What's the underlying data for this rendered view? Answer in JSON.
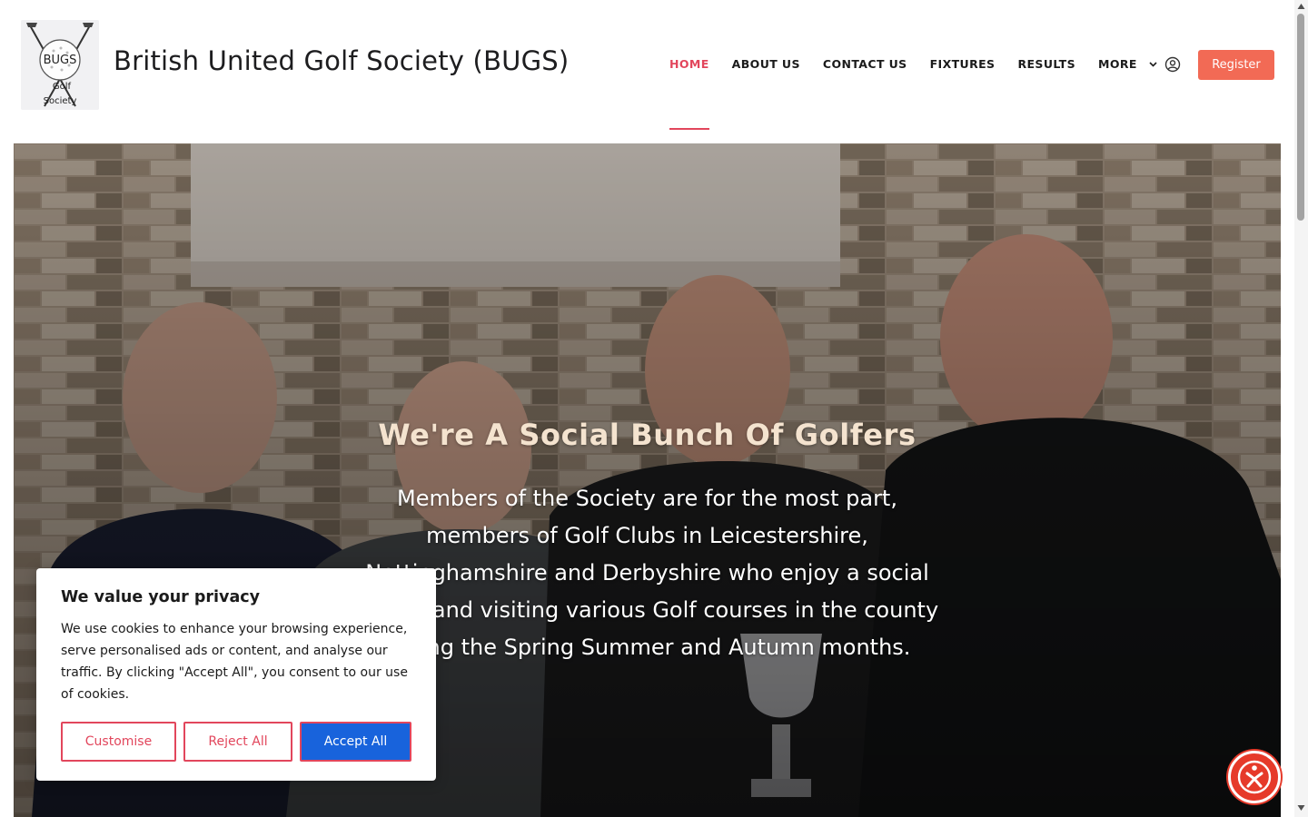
{
  "site": {
    "title": "British United Golf Society (BUGS)",
    "logo_text": [
      "BUGS",
      "Golf",
      "Society"
    ]
  },
  "nav": {
    "items": [
      {
        "label": "HOME",
        "active": true
      },
      {
        "label": "ABOUT US",
        "active": false
      },
      {
        "label": "CONTACT US",
        "active": false
      },
      {
        "label": "FIXTURES",
        "active": false
      },
      {
        "label": "RESULTS",
        "active": false
      },
      {
        "label": "MORE",
        "active": false,
        "icon": "chevron-down-icon"
      }
    ],
    "account_icon": "user-circle-icon",
    "register_label": "Register"
  },
  "hero": {
    "title": "We're A Social Bunch Of Golfers",
    "text": "Members of the Society are for the most part, members of Golf Clubs in Leicestershire, Nottinghamshire and Derbyshire who enjoy a social outing and visiting various Golf courses in the county during the Spring Summer and Autumn months."
  },
  "cookie": {
    "title": "We value your privacy",
    "text": "We use cookies to enhance your browsing experience, serve personalised ads or content, and analyse our traffic. By clicking \"Accept All\", you consent to our use of cookies.",
    "customise_label": "Customise",
    "reject_label": "Reject All",
    "accept_label": "Accept All"
  },
  "accessibility": {
    "icon": "accessibility-icon"
  },
  "colors": {
    "accent": "#e2465c",
    "register": "#f26a55",
    "accept": "#1863dc",
    "a11y": "#e63a2a"
  }
}
